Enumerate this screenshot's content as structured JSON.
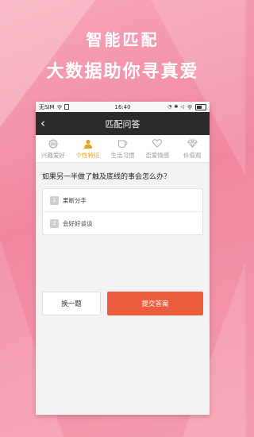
{
  "promo": {
    "line1": "智能匹配",
    "line2": "大数据助你寻真爱"
  },
  "status": {
    "carrier": "无SIM",
    "time": "16:40"
  },
  "nav": {
    "title": "匹配问答",
    "back_icon": "chevron-left-icon"
  },
  "tabs": [
    {
      "label": "兴趣爱好",
      "icon": "basketball-icon",
      "active": false
    },
    {
      "label": "个性特征",
      "icon": "person-icon",
      "active": true
    },
    {
      "label": "生活习惯",
      "icon": "coffee-cup-icon",
      "active": false
    },
    {
      "label": "恋爱情感",
      "icon": "heart-icon",
      "active": false
    },
    {
      "label": "价值观",
      "icon": "diamond-icon",
      "active": false
    }
  ],
  "question": "如果另一半做了触及底线的事会怎么办？",
  "options": [
    {
      "num": "1",
      "label": "果断分手"
    },
    {
      "num": "2",
      "label": "会好好谈谈"
    }
  ],
  "buttons": {
    "switch_label": "换一题",
    "submit_label": "提交答案"
  },
  "colors": {
    "accent_active": "#e8a21a",
    "submit": "#ec5d3d",
    "navbar": "#2b2b2b",
    "background": "#f1879f"
  }
}
